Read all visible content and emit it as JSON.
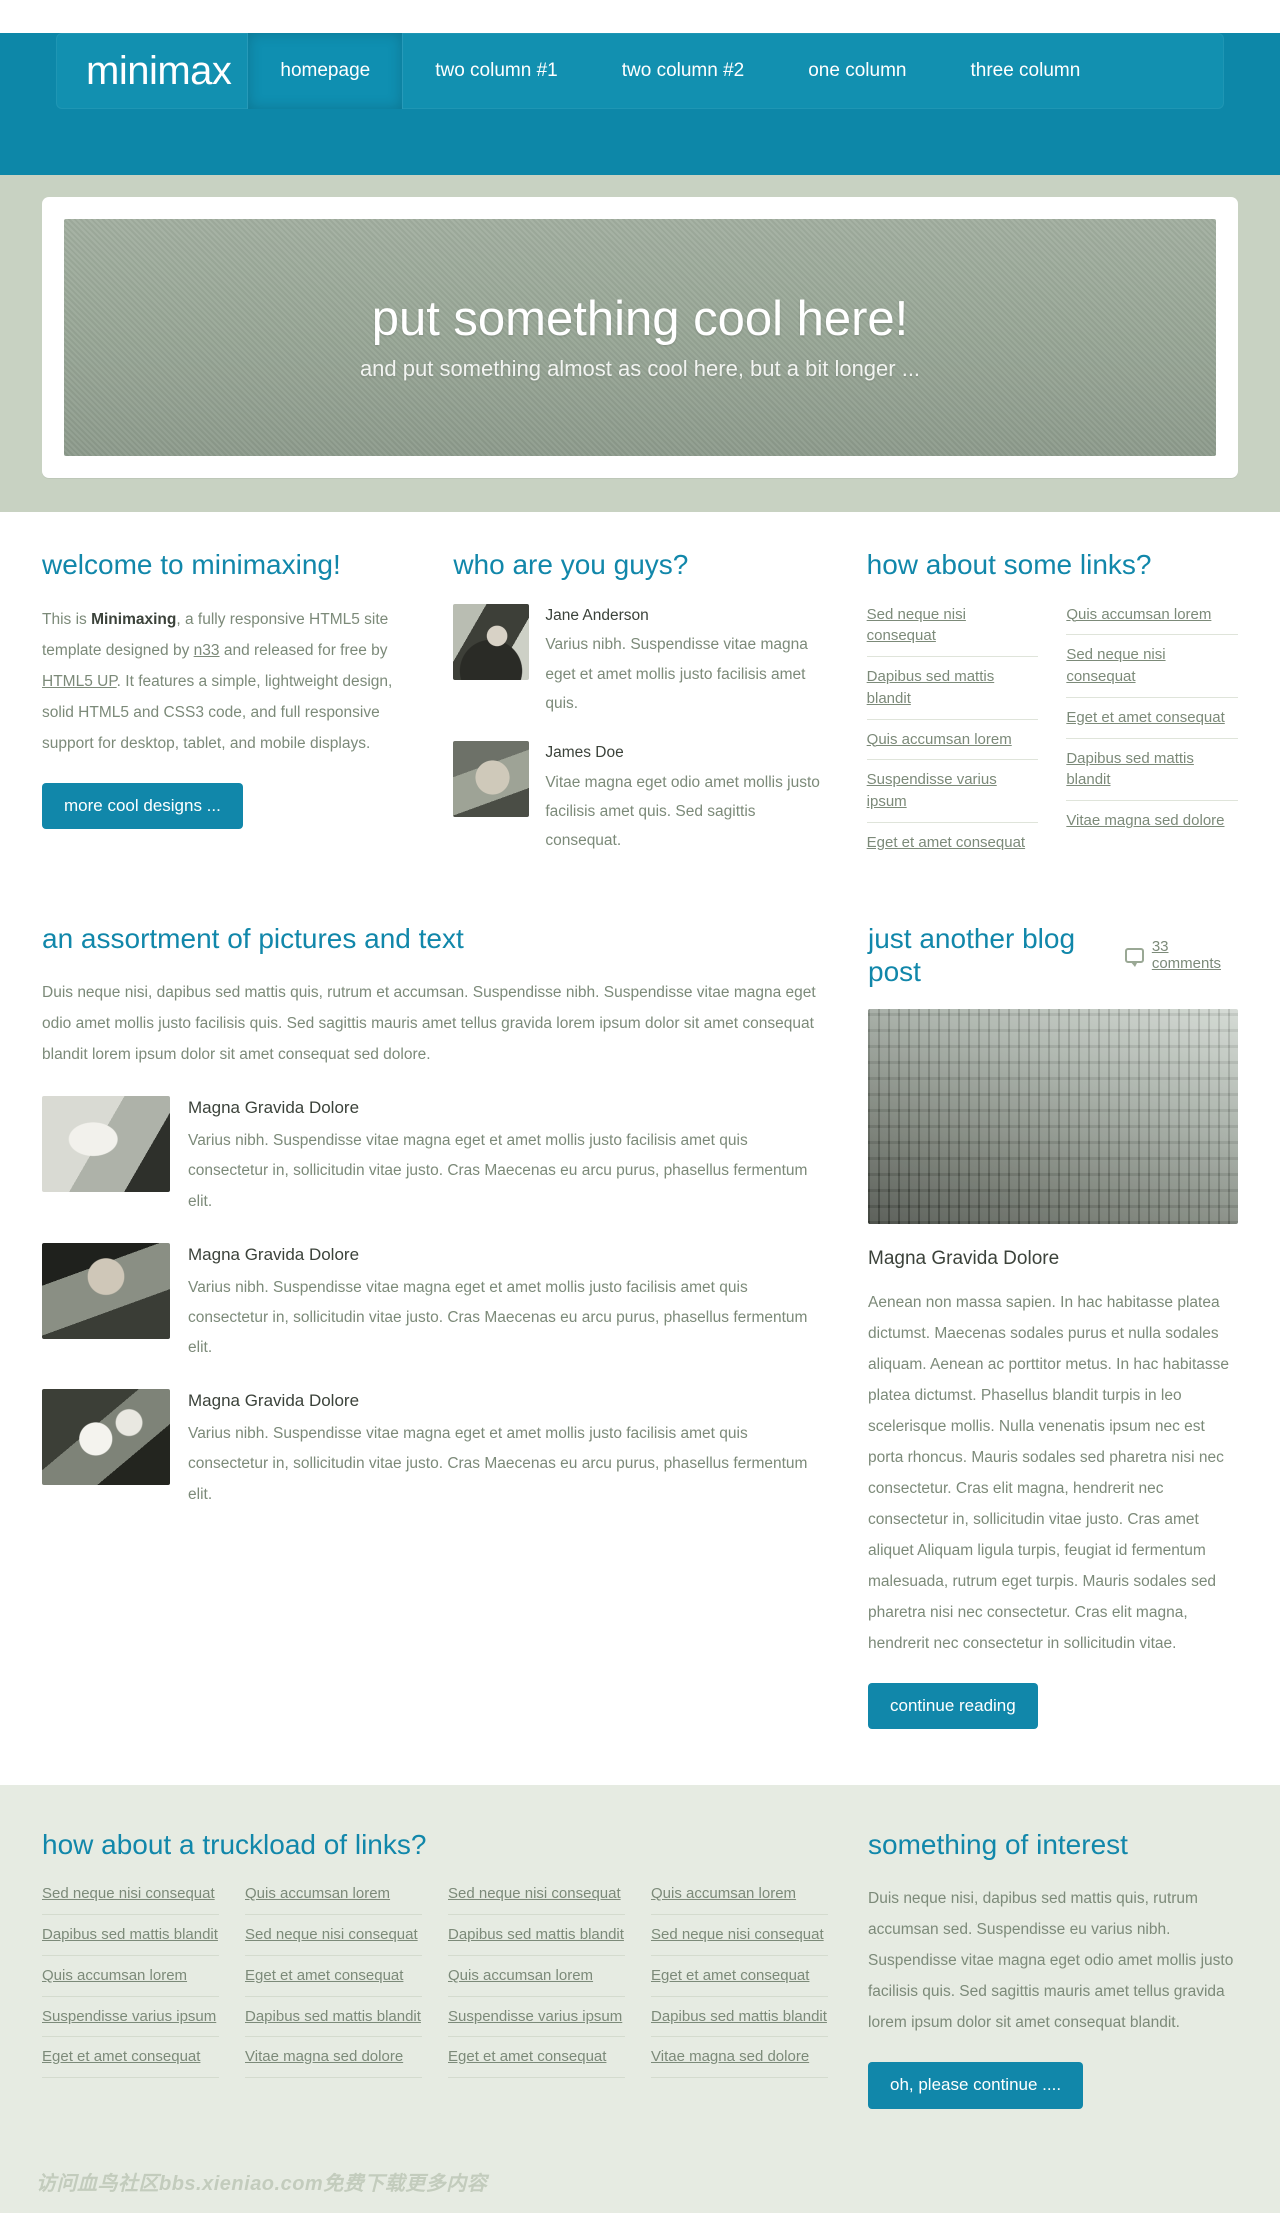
{
  "nav": {
    "brand": "minimax",
    "items": [
      {
        "label": "homepage",
        "active": true
      },
      {
        "label": "two column #1",
        "active": false
      },
      {
        "label": "two column #2",
        "active": false
      },
      {
        "label": "one column",
        "active": false
      },
      {
        "label": "three column",
        "active": false
      }
    ]
  },
  "banner": {
    "title": "put something cool here!",
    "subtitle": "and put something almost as cool here, but a bit longer ..."
  },
  "welcome": {
    "heading": "welcome to minimaxing!",
    "text_1": "This is ",
    "bold_1": "Minimaxing",
    "text_2": ", a fully responsive HTML5 site template designed by ",
    "link_1": "n33",
    "text_3": " and released for free by ",
    "link_2": "HTML5 UP",
    "text_4": ". It features a simple, lightweight design, solid HTML5 and CSS3 code, and full responsive support for desktop, tablet, and mobile displays.",
    "button": "more cool designs ..."
  },
  "people": {
    "heading": "who are you guys?",
    "items": [
      {
        "name": "Jane Anderson",
        "desc": "Varius nibh. Suspendisse vitae magna eget et amet mollis justo facilisis amet quis.",
        "avatar": "avatar-jane"
      },
      {
        "name": "James Doe",
        "desc": "Vitae magna eget odio amet mollis justo facilisis amet quis. Sed sagittis consequat.",
        "avatar": "avatar-james"
      }
    ]
  },
  "links_top": {
    "heading": "how about some links?",
    "col1": [
      "Sed neque nisi consequat",
      "Dapibus sed mattis blandit",
      "Quis accumsan lorem",
      "Suspendisse varius ipsum",
      "Eget et amet consequat"
    ],
    "col2": [
      "Quis accumsan lorem",
      "Sed neque nisi consequat",
      "Eget et amet consequat",
      "Dapibus sed mattis blandit",
      "Vitae magna sed dolore"
    ]
  },
  "assortment": {
    "heading": "an assortment of pictures and text",
    "intro": "Duis neque nisi, dapibus sed mattis quis, rutrum et accumsan. Suspendisse nibh. Suspendisse vitae magna eget odio amet mollis justo facilisis quis. Sed sagittis mauris amet tellus gravida lorem ipsum dolor sit amet consequat blandit lorem ipsum dolor sit amet consequat sed dolore.",
    "items": [
      {
        "title": "Magna Gravida Dolore",
        "text": "Varius nibh. Suspendisse vitae magna eget et amet mollis justo facilisis amet quis consectetur in, sollicitudin vitae justo. Cras Maecenas eu arcu purus, phasellus fermentum elit.",
        "thumb": "thumb-headphones"
      },
      {
        "title": "Magna Gravida Dolore",
        "text": "Varius nibh. Suspendisse vitae magna eget et amet mollis justo facilisis amet quis consectetur in, sollicitudin vitae justo. Cras Maecenas eu arcu purus, phasellus fermentum elit.",
        "thumb": "thumb-woman"
      },
      {
        "title": "Magna Gravida Dolore",
        "text": "Varius nibh. Suspendisse vitae magna eget et amet mollis justo facilisis amet quis consectetur in, sollicitudin vitae justo. Cras Maecenas eu arcu purus, phasellus fermentum elit.",
        "thumb": "thumb-flowers"
      }
    ]
  },
  "blog": {
    "heading": "just another blog post",
    "comments_count": "33 comments",
    "post_title": "Magna Gravida Dolore",
    "post_body": "Aenean non massa sapien. In hac habitasse platea dictumst. Maecenas sodales purus et nulla sodales aliquam. Aenean ac porttitor metus. In hac habitasse platea dictumst. Phasellus blandit turpis in leo scelerisque mollis. Nulla venenatis ipsum nec est porta rhoncus. Mauris sodales sed pharetra nisi nec consectetur. Cras elit magna, hendrerit nec consectetur in, sollicitudin vitae justo. Cras amet aliquet Aliquam ligula turpis, feugiat id fermentum malesuada, rutrum eget turpis. Mauris sodales sed pharetra nisi nec consectetur. Cras elit magna, hendrerit nec consectetur in sollicitudin vitae.",
    "button": "continue reading"
  },
  "footer": {
    "links_heading": "how about a truckload of links?",
    "col1": [
      "Sed neque nisi consequat",
      "Dapibus sed mattis blandit",
      "Quis accumsan lorem",
      "Suspendisse varius ipsum",
      "Eget et amet consequat"
    ],
    "col2": [
      "Quis accumsan lorem",
      "Sed neque nisi consequat",
      "Eget et amet consequat",
      "Dapibus sed mattis blandit",
      "Vitae magna sed dolore"
    ],
    "col3": [
      "Sed neque nisi consequat",
      "Dapibus sed mattis blandit",
      "Quis accumsan lorem",
      "Suspendisse varius ipsum",
      "Eget et amet consequat"
    ],
    "col4": [
      "Quis accumsan lorem",
      "Sed neque nisi consequat",
      "Eget et amet consequat",
      "Dapibus sed mattis blandit",
      "Vitae magna sed dolore"
    ],
    "interest_heading": "something of interest",
    "interest_text": "Duis neque nisi, dapibus sed mattis quis, rutrum accumsan sed. Suspendisse eu varius nibh. Suspendisse vitae magna eget odio amet mollis justo facilisis quis. Sed sagittis mauris amet tellus gravida lorem ipsum dolor sit amet consequat blandit.",
    "interest_button": "oh, please continue ....",
    "watermark": "访问血鸟社区bbs.xieniao.com免费下载更多内容"
  },
  "colors": {
    "brand": "#0d87a8",
    "nav_bg": "#1290b0",
    "heading": "#1187aa",
    "body_text": "#7c8a79",
    "banner_bg": "#c8d2c2",
    "footer_bg": "#e6ebe2"
  }
}
